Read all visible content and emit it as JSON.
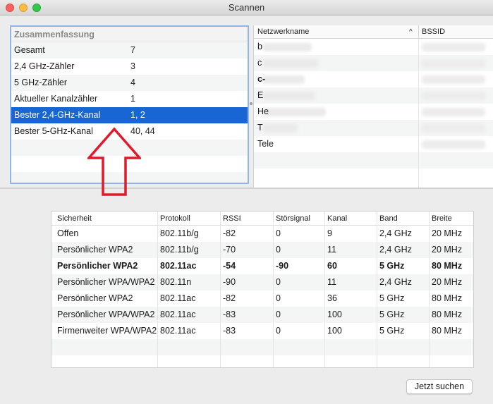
{
  "window": {
    "title": "Scannen"
  },
  "summary": {
    "header": "Zusammenfassung",
    "rows": [
      {
        "label": "Gesamt",
        "value": "7"
      },
      {
        "label": "2,4 GHz-Zähler",
        "value": "3"
      },
      {
        "label": "5 GHz-Zähler",
        "value": "4"
      },
      {
        "label": "Aktueller Kanalzähler",
        "value": "1"
      },
      {
        "label": "Bester 2,4-GHz-Kanal",
        "value": "1, 2"
      },
      {
        "label": "Bester 5-GHz-Kanal",
        "value": "40, 44"
      }
    ],
    "selected_index": 4
  },
  "networks": {
    "columns": {
      "name": "Netzwerkname",
      "bssid": "BSSID"
    },
    "sort_indicator": "^",
    "rows": [
      "b",
      "c",
      "c-",
      "E",
      "He",
      "T",
      "Tele"
    ]
  },
  "scan_table": {
    "columns": [
      "Sicherheit",
      "Protokoll",
      "RSSI",
      "Störsignal",
      "Kanal",
      "Band",
      "Breite"
    ],
    "rows": [
      [
        "Offen",
        "802.11b/g",
        "-82",
        "0",
        "9",
        "2,4 GHz",
        "20 MHz"
      ],
      [
        "Persönlicher WPA2",
        "802.11b/g",
        "-70",
        "0",
        "11",
        "2,4 GHz",
        "20 MHz"
      ],
      [
        "Persönlicher WPA2",
        "802.11ac",
        "-54",
        "-90",
        "60",
        "5 GHz",
        "80 MHz"
      ],
      [
        "Persönlicher WPA/WPA2",
        "802.11n",
        "-90",
        "0",
        "11",
        "2,4 GHz",
        "20 MHz"
      ],
      [
        "Persönlicher WPA2",
        "802.11ac",
        "-82",
        "0",
        "36",
        "5 GHz",
        "80 MHz"
      ],
      [
        "Persönlicher WPA/WPA2",
        "802.11ac",
        "-83",
        "0",
        "100",
        "5 GHz",
        "80 MHz"
      ],
      [
        "Firmenweiter WPA/WPA2",
        "802.11ac",
        "-83",
        "0",
        "100",
        "5 GHz",
        "80 MHz"
      ]
    ],
    "bold_row_index": 2
  },
  "footer": {
    "scan_button": "Jetzt suchen"
  },
  "colors": {
    "selection": "#1866d4",
    "arrow": "#e0192b",
    "focus_ring": "#8fb6e6"
  }
}
